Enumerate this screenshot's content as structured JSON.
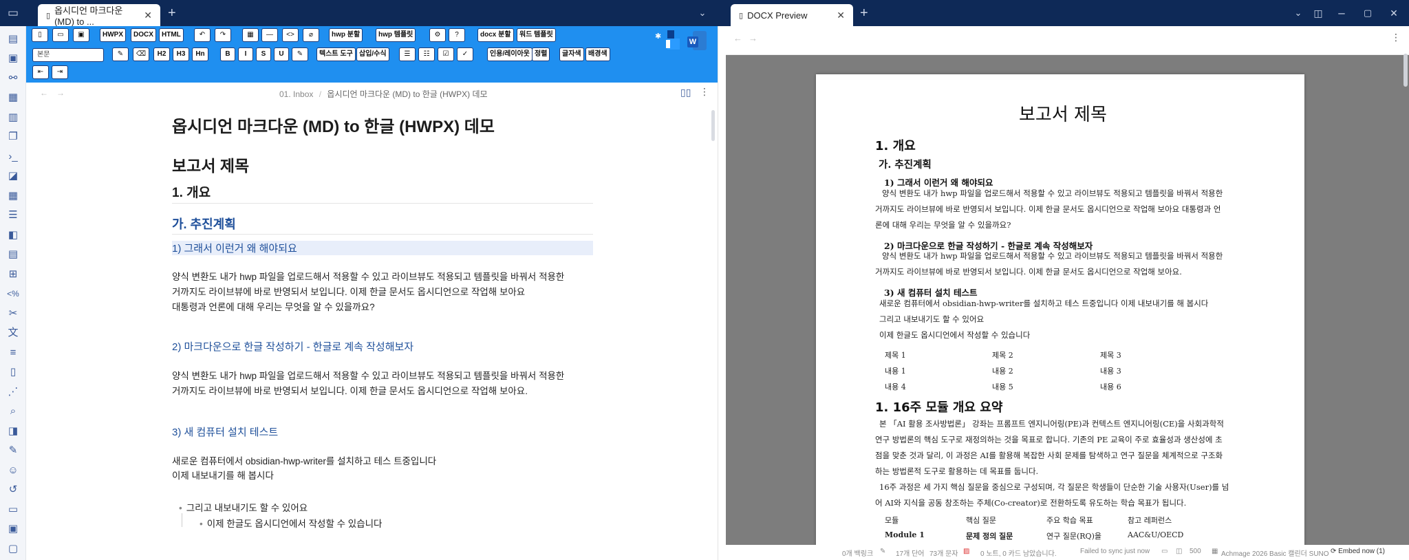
{
  "title_bar": {
    "left_tab_title": "옵시디언 마크다운 (MD) to ...",
    "right_tab_title": "DOCX Preview"
  },
  "toolbar": {
    "row1": [
      "HWPX",
      "DOCX",
      "HTML"
    ],
    "hwp_split": "hwp 분할",
    "hwp_template": "hwp 템플릿",
    "docx_split": "docx 분할",
    "word_template": "워드 템플릿",
    "style_select": "본문",
    "headings": [
      "H2",
      "H3",
      "Hn"
    ],
    "text_format": [
      "B",
      "I",
      "S",
      "U"
    ],
    "text_tools": "텍스트 도구",
    "insert_format": "삽입/수식",
    "quote_layout": "인용/레이아웃",
    "align": "정렬",
    "font_color": "글자색",
    "bg_color": "배경색"
  },
  "breadcrumb": {
    "folder": "01. Inbox",
    "file": "옵시디언 마크다운 (MD) to 한글 (HWPX) 데모"
  },
  "editor": {
    "main_title": "옵시디언 마크다운 (MD) to 한글 (HWPX) 데모",
    "report_title": "보고서 제목",
    "h_overview": "1. 개요",
    "h_plan": "가. 추진계획",
    "h_why": "1) 그래서 이런거 왜 해야되요",
    "p1_line1": "양식 변환도 내가 hwp 파일을 업로드해서 적용할 수 있고 라이브뷰도 적용되고 템플릿을 바꿔서 적용한",
    "p1_line2": "거까지도 라이브뷰에 바로 반영되서 보입니다. 이제 한글 문서도 옵시디언으로 작업해 보아요",
    "p1_line3": "대통령과 언론에 대해 우리는 무엇을 알 수 있을까요?",
    "h_md": "2) 마크다운으로 한글 작성하기 - 한글로 계속 작성해보자",
    "p2_line1": "양식 변환도 내가 hwp 파일을 업로드해서 적용할 수 있고 라이브뷰도 적용되고 템플릿을 바꿔서 적용한",
    "p2_line2": "거까지도 라이브뷰에 바로 반영되서 보입니다. 이제 한글 문서도 옵시디언으로 작업해 보아요.",
    "h_test": "3)  새 컴퓨터 설치 테스트",
    "p3_line1": "새로운 컴퓨터에서 obsidian-hwp-writer를 설치하고 테스 트중입니다",
    "p3_line2": "이제 내보내기를 해 봅시다",
    "bullet1": "그리고 내보내기도 할 수 있어요",
    "bullet2": "이제 한글도 옵시디언에서 작성할 수 있습니다"
  },
  "preview": {
    "title": "보고서 제목",
    "h1": "1. 개요",
    "h2": "가. 추진계획",
    "h3a": "1) 그래서 이런거 왜 해야되요",
    "p1": [
      "양식 변환도 내가 hwp 파일을 업로드해서 적용할 수 있고 라이브뷰도 적용되고 템플릿을 바꿔서 적용한",
      "거까지도 라이브뷰에 바로 반영되서 보입니다. 이제 한글 문서도 옵시디언으로 작업해 보아요 대통령과 언",
      "론에 대해 우리는 무엇을 알 수 있을까요?"
    ],
    "h3b": "2) 마크다운으로 한글 작성하기 - 한글로 계속 작성해보자",
    "p2": [
      "양식 변환도 내가 hwp 파일을 업로드해서 적용할 수 있고 라이브뷰도 적용되고 템플릿을 바꿔서 적용한",
      "거까지도 라이브뷰에 바로 반영되서 보입니다. 이제 한글 문서도 옵시디언으로 작업해 보아요."
    ],
    "h3c": "3) 새 컴퓨터 설치 테스트",
    "p3": [
      "새로운 컴퓨터에서 obsidian-hwp-writer를 설치하고 테스 트중입니다 이제 내보내기를 해 봅시다",
      "그리고 내보내기도 할 수 있어요",
      "이제 한글도 옵시디언에서 작성할 수 있습니다"
    ],
    "table": [
      [
        "제목 1",
        "제목 2",
        "제목 3"
      ],
      [
        "내용 1",
        "내용 2",
        "내용 3"
      ],
      [
        "내용 4",
        "내용 5",
        "내용 6"
      ]
    ],
    "h1b": "1. 16주 모듈 개요 요약",
    "p4": [
      "본 「AI 활용 조사방법론」 강좌는 프롬프트 엔지니어링(PE)과 컨텍스트 엔지니어링(CE)을 사회과학적",
      "연구 방법론의 핵심 도구로 재정의하는 것을 목표로 합니다. 기존의 PE 교육이 주로 효율성과 생산성에 초",
      "점을 맞춘 것과 달리, 이 과정은 AI를 활용해 복잡한 사회 문제를 탐색하고 연구 질문을 체계적으로 구조화",
      "하는 방법론적 도구로 활용하는 데 목표를 둡니다."
    ],
    "p5": [
      "16주 과정은 세 가지 핵심 질문을 중심으로 구성되며, 각 질문은 학생들이 단순한 기술 사용자(User)를 넘",
      "어 AI와 지식을 공동 창조하는 주체(Co-creator)로 전환하도록 유도하는 학습 목표가 됩니다."
    ],
    "table2_header": [
      "모듈",
      "핵심 질문",
      "주요 학습 목표",
      "참고 레퍼런스"
    ],
    "table2_row": [
      "Module 1",
      "문제  정의  질문",
      "연구   질문(RQ)을",
      "AAC&U/OECD"
    ]
  },
  "status_bar": {
    "backlinks": "0개 백링크",
    "words": "17개 단어",
    "chars": "73개 문자",
    "cards": "0 노트, 0 카드 남았습니다.",
    "sync": "Failed to sync just now",
    "count": "500",
    "plugin": "Achmage 2026 Basic 캘린더 SUNO",
    "embed": "Embed now (1)"
  }
}
